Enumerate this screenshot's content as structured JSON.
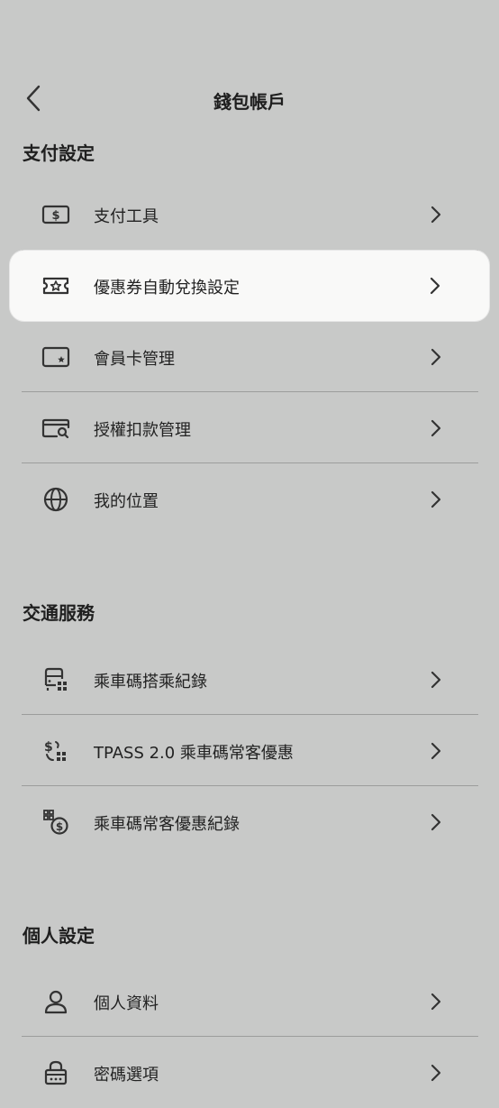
{
  "header": {
    "title": "錢包帳戶"
  },
  "sections": [
    {
      "title": "支付設定",
      "items": [
        {
          "label": "支付工具",
          "icon": "cash-icon"
        },
        {
          "label": "優惠券自動兌換設定",
          "icon": "coupon-icon"
        },
        {
          "label": "會員卡管理",
          "icon": "member-card-icon"
        },
        {
          "label": "授權扣款管理",
          "icon": "authorized-debit-icon"
        },
        {
          "label": "我的位置",
          "icon": "globe-icon"
        }
      ]
    },
    {
      "title": "交通服務",
      "items": [
        {
          "label": "乘車碼搭乘紀錄",
          "icon": "bus-code-icon"
        },
        {
          "label": "TPASS 2.0 乘車碼常客優惠",
          "icon": "tpass-icon"
        },
        {
          "label": "乘車碼常客優惠紀錄",
          "icon": "frequent-rider-icon"
        }
      ]
    },
    {
      "title": "個人設定",
      "items": [
        {
          "label": "個人資料",
          "icon": "person-icon"
        },
        {
          "label": "密碼選項",
          "icon": "lock-icon"
        }
      ]
    }
  ],
  "colors": {
    "background": "#c8c9c8",
    "highlight": "#f9f9f8",
    "divider": "#9c9d9c"
  }
}
